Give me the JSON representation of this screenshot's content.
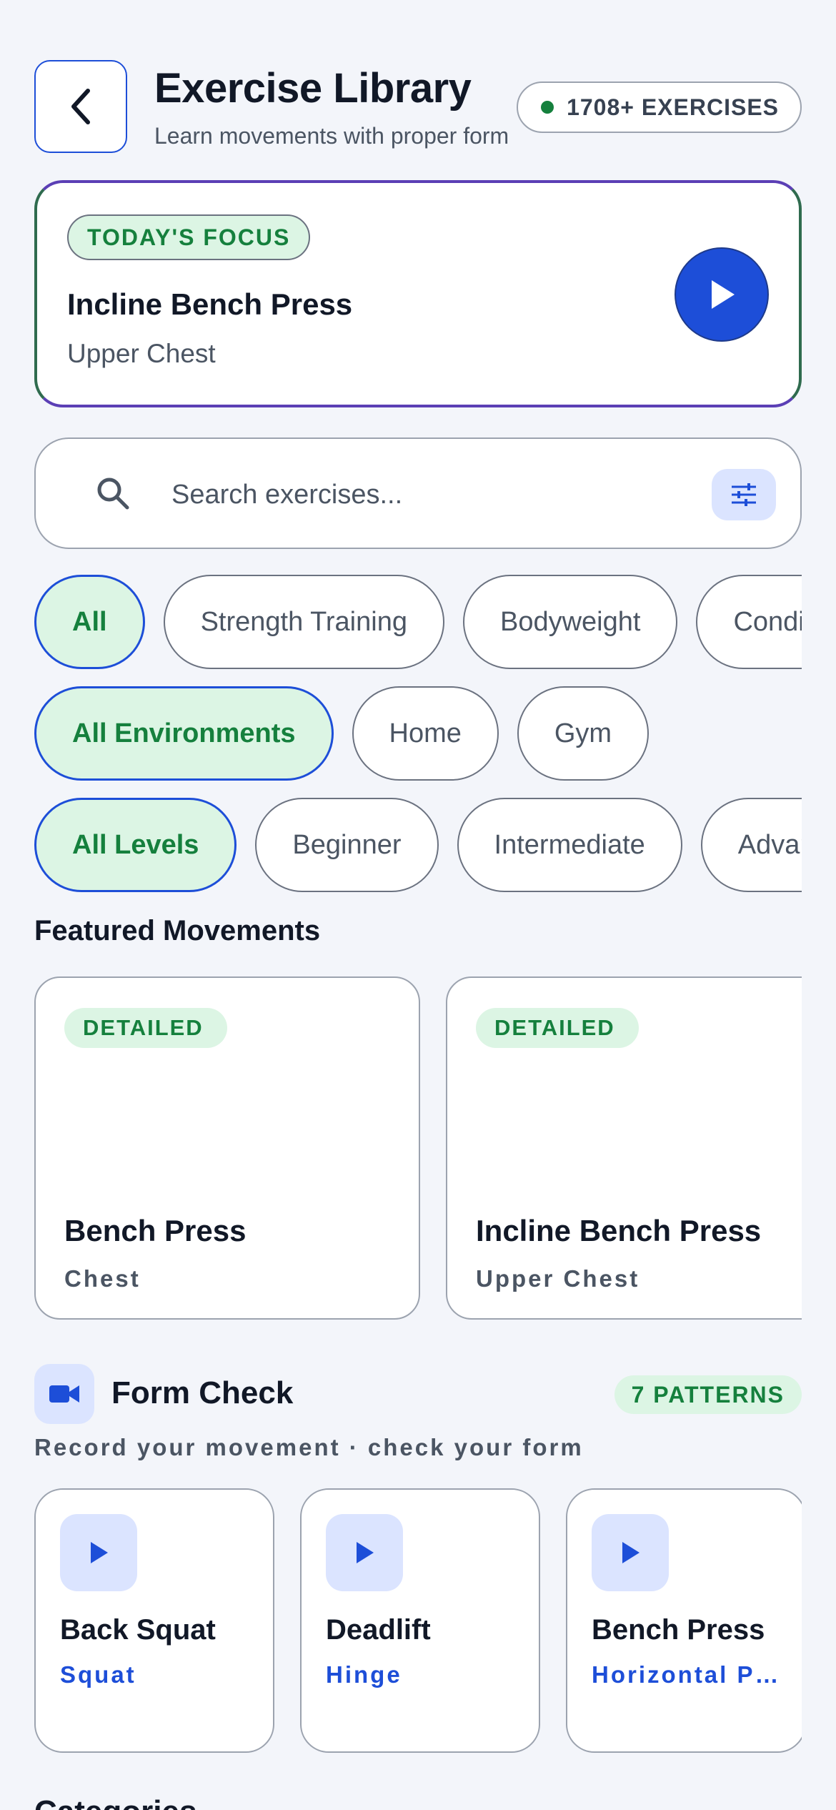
{
  "header": {
    "title": "Exercise Library",
    "subtitle": "Learn movements with proper form",
    "count_label": "1708+ EXERCISES",
    "back_icon": "chevron-left-icon"
  },
  "focus": {
    "badge": "TODAY'S FOCUS",
    "exercise": "Incline Bench Press",
    "muscle": "Upper Chest",
    "play_icon": "play-icon"
  },
  "search": {
    "placeholder": "Search exercises...",
    "value": "",
    "filter_icon": "sliders-icon"
  },
  "filters": {
    "types": [
      {
        "label": "All",
        "active": true
      },
      {
        "label": "Strength Training",
        "active": false
      },
      {
        "label": "Bodyweight",
        "active": false
      },
      {
        "label": "Conditioning",
        "active": false
      }
    ],
    "environments": [
      {
        "label": "All Environments",
        "active": true
      },
      {
        "label": "Home",
        "active": false
      },
      {
        "label": "Gym",
        "active": false
      }
    ],
    "levels": [
      {
        "label": "All Levels",
        "active": true
      },
      {
        "label": "Beginner",
        "active": false
      },
      {
        "label": "Intermediate",
        "active": false
      },
      {
        "label": "Advanced",
        "active": false
      }
    ]
  },
  "featured": {
    "title": "Featured Movements",
    "cards": [
      {
        "tag": "DETAILED",
        "name": "Bench Press",
        "muscle": "Chest"
      },
      {
        "tag": "DETAILED",
        "name": "Incline Bench Press",
        "muscle": "Upper Chest"
      }
    ]
  },
  "form_check": {
    "title": "Form Check",
    "badge": "7 PATTERNS",
    "subtitle": "Record your movement · check your form",
    "icon": "video-camera-icon",
    "patterns": [
      {
        "name": "Back Squat",
        "type": "Squat"
      },
      {
        "name": "Deadlift",
        "type": "Hinge"
      },
      {
        "name": "Bench Press",
        "type": "Horizontal Push"
      }
    ]
  },
  "categories": {
    "title": "Categories"
  },
  "colors": {
    "accent_blue": "#1d4ed8",
    "accent_green": "#15803d",
    "chip_active_bg": "#dcf5e4",
    "icon_bg": "#dbe4ff",
    "page_bg": "#f3f5fa"
  }
}
